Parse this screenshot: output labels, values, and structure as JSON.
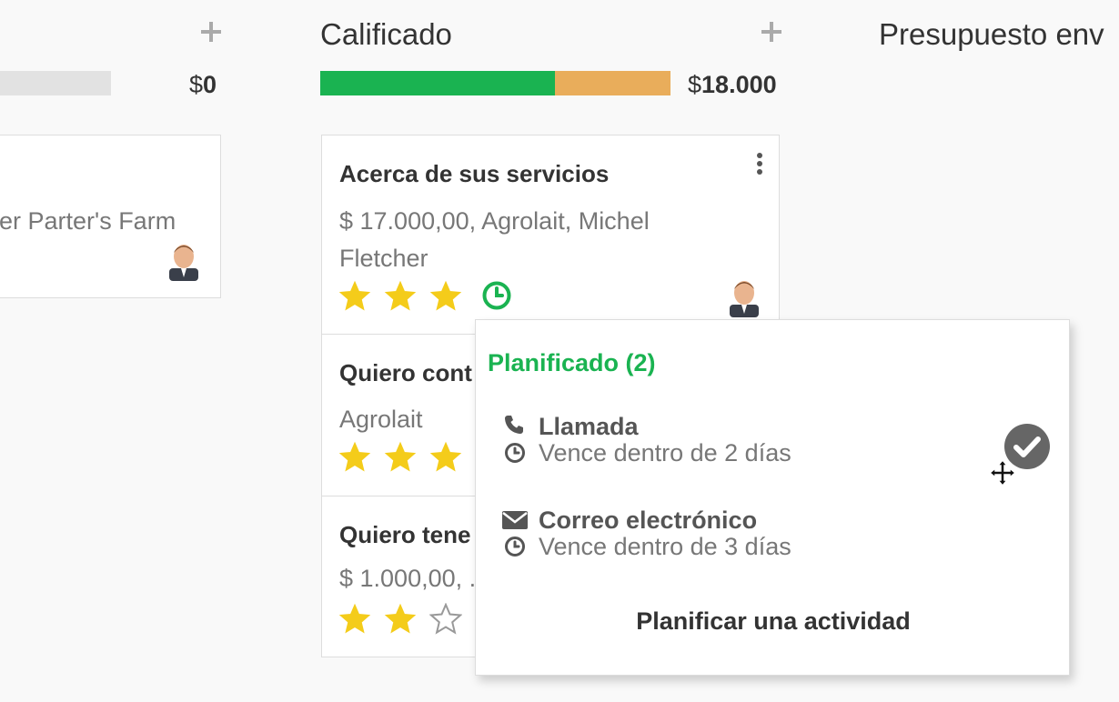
{
  "columns": [
    {
      "title": "",
      "total_currency": "$",
      "total_amount": "0",
      "progress": {
        "won": 0,
        "other": 0
      }
    },
    {
      "title": "Calificado",
      "total_currency": "$",
      "total_amount": "18.000",
      "progress": {
        "won": 0.67,
        "other": 0.33
      }
    },
    {
      "title": "Presupuesto env"
    }
  ],
  "left_card": {
    "subtitle": "er Parter's Farm"
  },
  "cards": [
    {
      "title": "Acerca de sus servicios",
      "subtitle": "$ 17.000,00, Agrolait, Michel Fletcher",
      "stars": 3
    },
    {
      "title": "Quiero cont",
      "subtitle": "Agrolait",
      "stars": 3
    },
    {
      "title": "Quiero tene",
      "subtitle": "$ 1.000,00, .",
      "stars": 2
    }
  ],
  "activity_popover": {
    "title": "Planificado (2)",
    "activities": [
      {
        "icon": "phone-icon",
        "title": "Llamada",
        "due": "Vence dentro de 2 días"
      },
      {
        "icon": "envelope-icon",
        "title": "Correo electrónico",
        "due": "Vence dentro de 3 días"
      }
    ],
    "schedule_label": "Planificar una actividad"
  },
  "colors": {
    "accent_green": "#1ab351",
    "progress_orange": "#e9ad5b",
    "star_yellow": "#f4cc1a"
  }
}
